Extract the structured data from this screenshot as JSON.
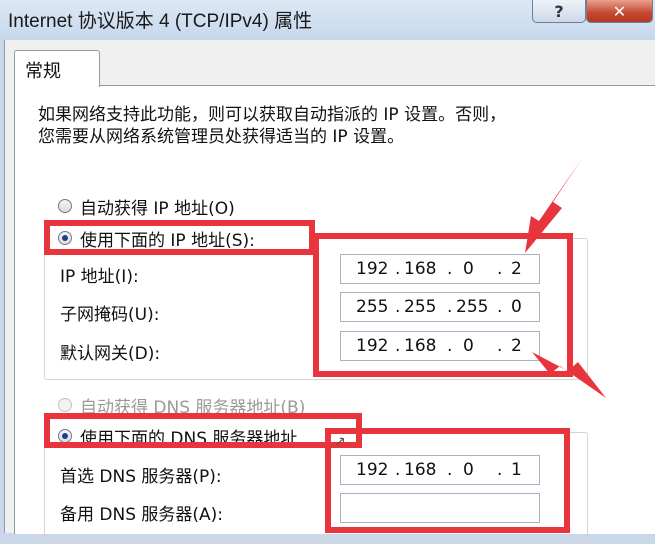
{
  "window": {
    "title": "Internet 协议版本 4 (TCP/IPv4) 属性",
    "help_button": "?",
    "close_button": "✕"
  },
  "tabs": [
    {
      "label": "常规"
    }
  ],
  "description": {
    "line1": "如果网络支持此功能，则可以获取自动指派的 IP 设置。否则，",
    "line2": "您需要从网络系统管理员处获得适当的 IP 设置。"
  },
  "ip": {
    "auto_label": "自动获得 IP 地址(O)",
    "manual_label": "使用下面的 IP 地址(S):",
    "selected": "manual",
    "fields": [
      {
        "label": "IP 地址(I):",
        "octets": [
          "192",
          "168",
          "0",
          "2"
        ]
      },
      {
        "label": "子网掩码(U):",
        "octets": [
          "255",
          "255",
          "255",
          "0"
        ]
      },
      {
        "label": "默认网关(D):",
        "octets": [
          "192",
          "168",
          "0",
          "2"
        ]
      }
    ]
  },
  "dns": {
    "auto_label": "自动获得 DNS 服务器地址(B)",
    "manual_label": "使用下面的 DNS 服务器地址",
    "selected": "manual",
    "fields": [
      {
        "label": "首选 DNS 服务器(P):",
        "octets": [
          "192",
          "168",
          "0",
          "1"
        ]
      },
      {
        "label": "备用 DNS 服务器(A):",
        "octets": [
          "",
          "",
          "",
          ""
        ]
      }
    ]
  },
  "colors": {
    "annotation": "#e8343c",
    "selected_radio": "#1b3f91"
  }
}
